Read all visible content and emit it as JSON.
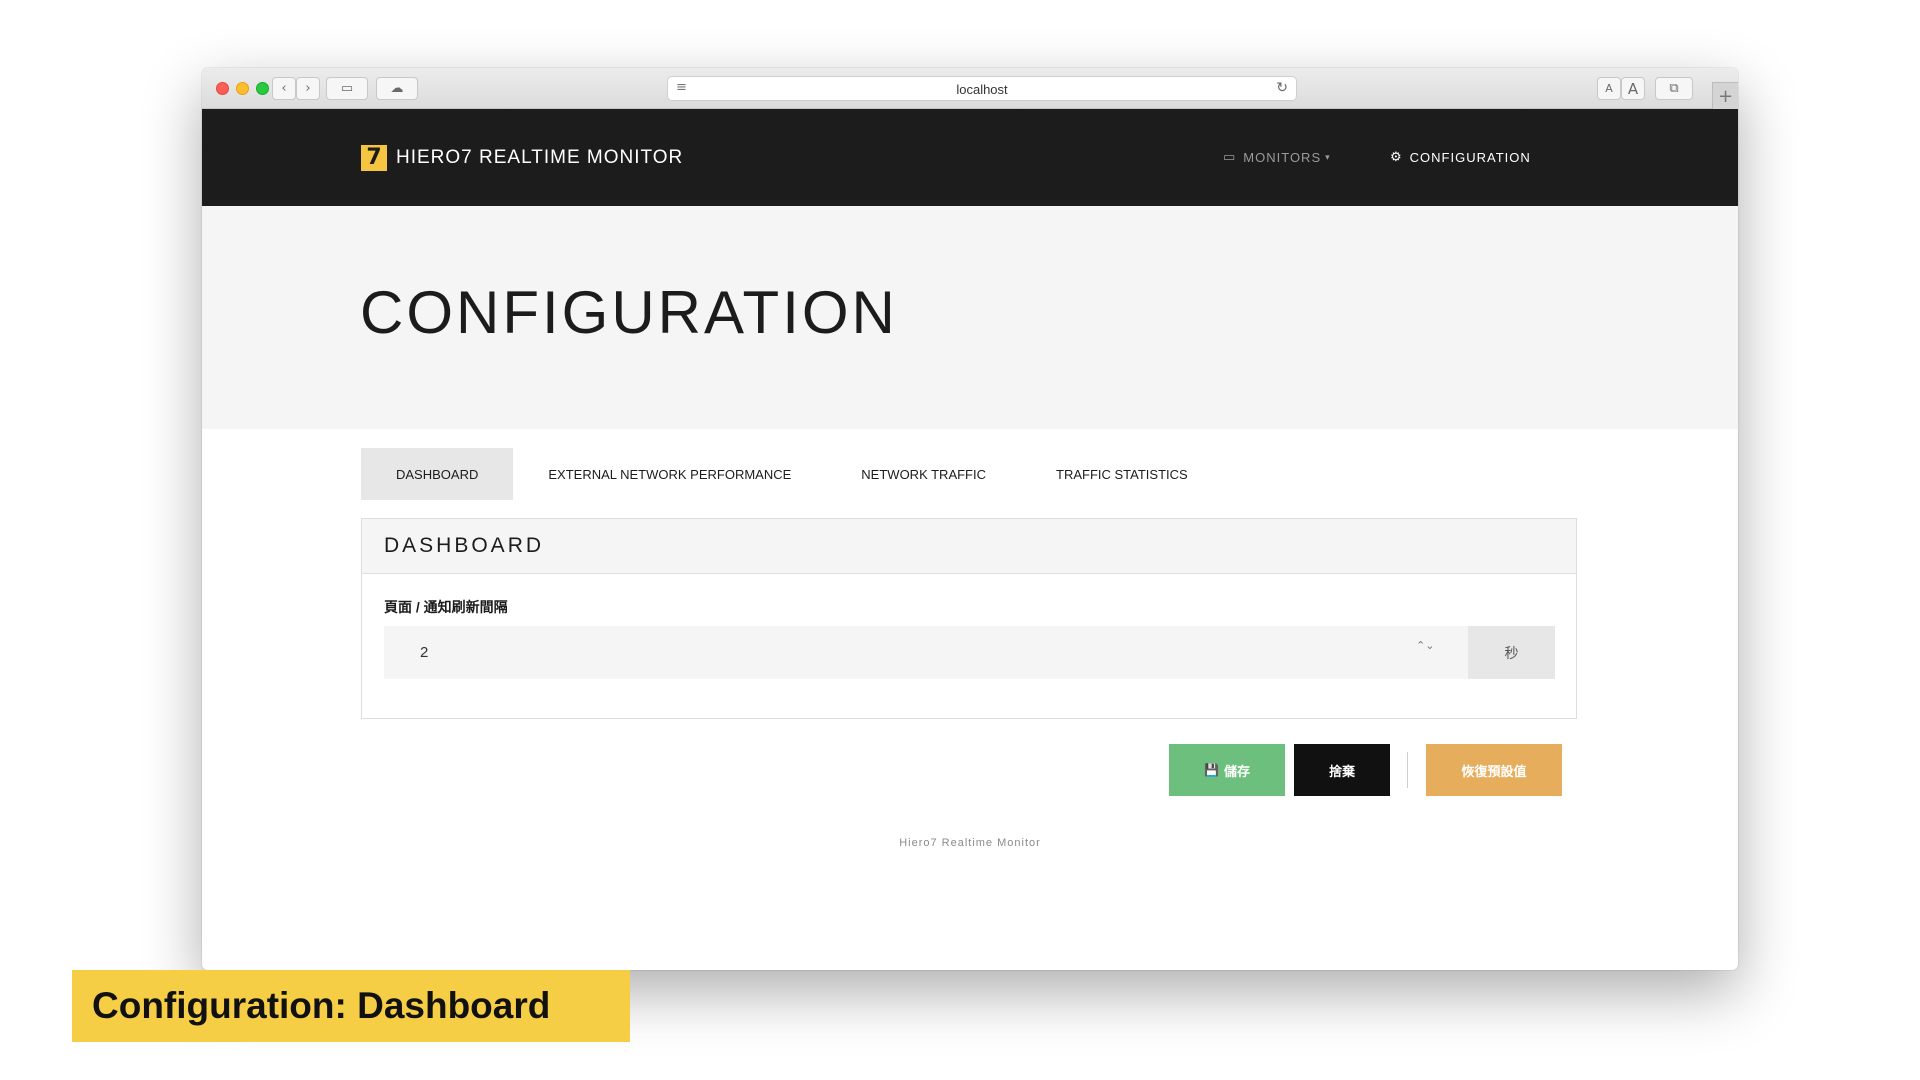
{
  "browser": {
    "url": "localhost",
    "buttons": {
      "back": "‹",
      "forward": "›",
      "sidebar": "▭",
      "cloud": "☁",
      "reader": "≡",
      "reload": "↻",
      "font_small": "A",
      "font_large": "A",
      "tabs": "⧉",
      "new_tab": "+"
    }
  },
  "navbar": {
    "logo_char": "7",
    "brand": "HIERO7 REALTIME MONITOR",
    "monitors_label": "MONITORS",
    "monitors_icon": "▭",
    "caret": "▾",
    "configuration_label": "CONFIGURATION",
    "configuration_icon": "⚙"
  },
  "hero": {
    "title": "CONFIGURATION"
  },
  "tabs": [
    {
      "label": "DASHBOARD",
      "active": true
    },
    {
      "label": "EXTERNAL NETWORK PERFORMANCE",
      "active": false
    },
    {
      "label": "NETWORK TRAFFIC",
      "active": false
    },
    {
      "label": "TRAFFIC STATISTICS",
      "active": false
    }
  ],
  "panel": {
    "title": "DASHBOARD",
    "field_label": "頁面 / 通知刷新間隔",
    "field_value": "2",
    "spinner": "⌃⌄",
    "unit": "秒"
  },
  "actions": {
    "save_icon": "💾",
    "save_label": "儲存",
    "discard_label": "捨棄",
    "reset_label": "恢復預設值"
  },
  "footer": {
    "text": "Hiero7 Realtime Monitor"
  },
  "caption": {
    "text": "Configuration: Dashboard"
  },
  "colors": {
    "navbar_bg": "#1c1c1c",
    "logo": "#f5c542",
    "save": "#6cbf7d",
    "discard": "#111111",
    "reset": "#e6ad5c",
    "caption_bg": "#f6ce45"
  }
}
